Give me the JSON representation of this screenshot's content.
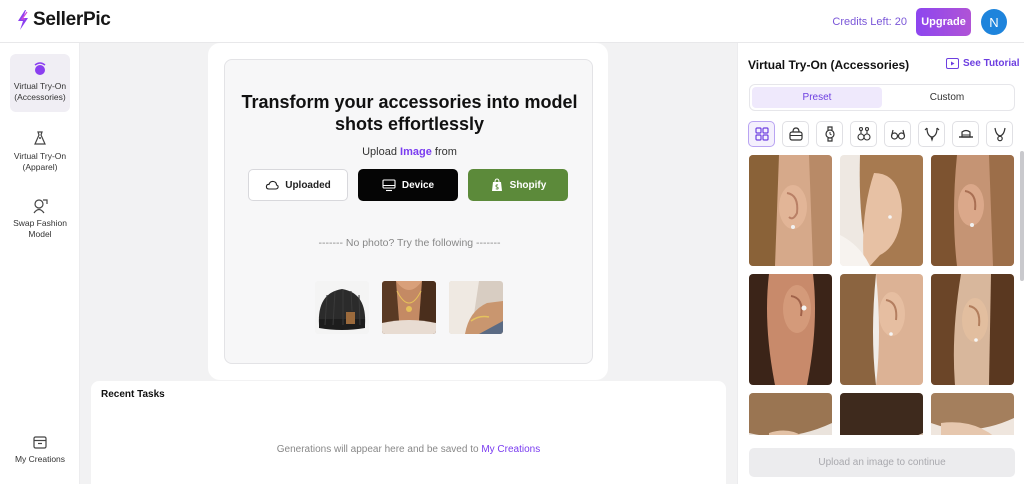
{
  "header": {
    "logo_text": "SellerPic",
    "credits": "Credits Left: 20",
    "upgrade_label": "Upgrade",
    "avatar_initial": "N",
    "colors": {
      "accent": "#7a3cf0",
      "avatar": "#1e84dc"
    }
  },
  "sidebar": {
    "items": [
      {
        "label": "Virtual Try-On (Accessories)",
        "icon": "accessories-icon",
        "active": true
      },
      {
        "label": "Virtual Try-On (Apparel)",
        "icon": "apparel-icon",
        "active": false
      },
      {
        "label": "Swap Fashion Model",
        "icon": "swap-model-icon",
        "active": false
      },
      {
        "label": "My Creations",
        "icon": "folder-icon",
        "active": false
      }
    ]
  },
  "main": {
    "headline": "Transform your accessories into model shots effortlessly",
    "upload_prefix": "Upload",
    "upload_highlight": "Image",
    "upload_suffix": "from",
    "sources": [
      {
        "label": "Uploaded",
        "icon": "cloud-icon"
      },
      {
        "label": "Device",
        "icon": "monitor-icon"
      },
      {
        "label": "Shopify",
        "icon": "shopify-bag-icon"
      }
    ],
    "no_photo": "------- No photo? Try the following -------",
    "samples": [
      "beanie-sample",
      "necklace-sample",
      "bracelet-sample"
    ]
  },
  "tasks": {
    "title": "Recent Tasks",
    "empty_prefix": "Generations will appear here and be saved to",
    "empty_link": "My Creations"
  },
  "panel": {
    "title": "Virtual Try-On (Accessories)",
    "tutorial": "See Tutorial",
    "tabs": [
      {
        "label": "Preset",
        "active": true
      },
      {
        "label": "Custom",
        "active": false
      }
    ],
    "categories": [
      "grid-icon",
      "bag-icon",
      "watch-icon",
      "earring-icon",
      "glasses-icon",
      "necklace-icon",
      "hat-icon",
      "pendant-icon"
    ],
    "presets": [
      "earring-model-1",
      "earring-model-2",
      "earring-model-3",
      "earring-model-4",
      "earring-model-5",
      "earring-model-6",
      "earring-model-7",
      "earring-model-8",
      "earring-model-9"
    ],
    "continue_label": "Upload an image to continue"
  }
}
